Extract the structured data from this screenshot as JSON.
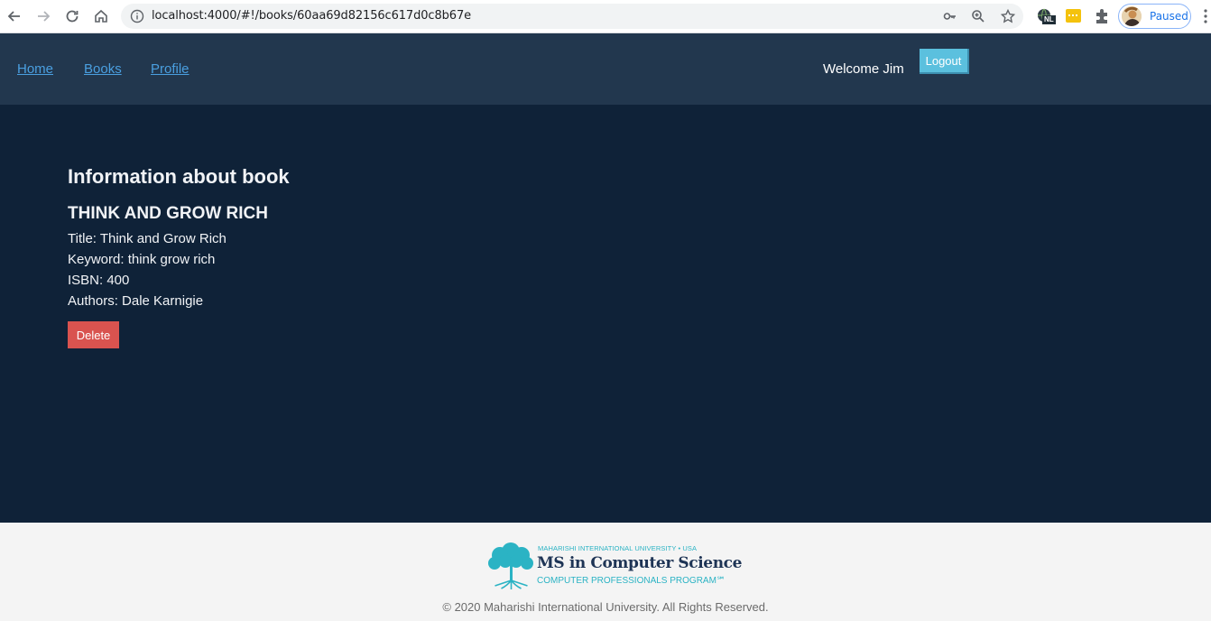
{
  "browser": {
    "url": "localhost:4000/#!/books/60aa69d82156c617d0c8b67e",
    "profile_label": "Paused",
    "ext_badge": "NL"
  },
  "header": {
    "nav": [
      {
        "label": "Home"
      },
      {
        "label": "Books"
      },
      {
        "label": "Profile"
      }
    ],
    "welcome": "Welcome Jim",
    "logout_label": "Logout"
  },
  "book": {
    "section_title": "Information about book",
    "name_upper": "THINK AND GROW RICH",
    "title_line": "Title: Think and Grow Rich",
    "keyword_line": "Keyword: think grow rich",
    "isbn_line": "ISBN: 400",
    "authors_line": "Authors: Dale Karnigie",
    "delete_label": "Delete"
  },
  "footer": {
    "logo_top": "MAHARISHI INTERNATIONAL UNIVERSITY • USA",
    "logo_main": "MS in Computer Science",
    "logo_sub": "COMPUTER PROFESSIONALS PROGRAM℠",
    "copyright": "© 2020 Maharishi International University. All Rights Reserved."
  },
  "colors": {
    "header_bg": "#22374e",
    "main_bg": "#0f2238",
    "link": "#4a9fe0",
    "logout_bg": "#5bc0de",
    "delete_bg": "#d9534f"
  }
}
